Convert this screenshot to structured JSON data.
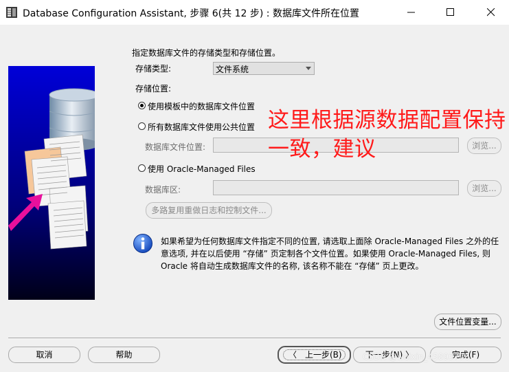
{
  "window": {
    "title": "Database Configuration Assistant, 步骤 6(共 12 步) : 数据库文件所在位置",
    "icon": "app-window-icon",
    "controls": [
      "minimize-icon",
      "maximize-icon",
      "close-icon"
    ]
  },
  "form": {
    "intro": "指定数据库文件的存储类型和存储位置。",
    "storage_type_label": "存储类型:",
    "storage_type_value": "文件系统",
    "storage_location_label": "存储位置:",
    "options": {
      "template": "使用模板中的数据库文件位置",
      "common": "所有数据库文件使用公共位置",
      "omf": "使用 Oracle-Managed Files"
    },
    "selected_option": "template",
    "db_file_location_label": "数据库文件位置:",
    "db_file_location_value": "",
    "browse_label": "浏览...",
    "db_area_label": "数据库区:",
    "db_area_value": "",
    "multiplex_label": "多路复用重做日志和控制文件..."
  },
  "info": {
    "text": "如果希望为任何数据库文件指定不同的位置, 请选取上面除 Oracle-Managed Files 之外的任意选项, 并在以后使用 “存储” 页定制各个文件位置。如果使用 Oracle-Managed Files, 则 Oracle 将自动生成数据库文件的名称, 该名称不能在 “存储” 页上更改。"
  },
  "annotation": {
    "text": "这里根据源数据配置保持一致，建议",
    "color": "#ff1a1a"
  },
  "buttons": {
    "file_location_vars": "文件位置变量...",
    "cancel": "取消",
    "help": "帮助",
    "back": "上一步(B)",
    "next": "下一步(N)",
    "finish": "完成(F)"
  },
  "watermark": "CSDN @weixin_45893776",
  "colors": {
    "accent_blue": "#0000cc",
    "annotation_red": "#ff1a1a",
    "arrow_magenta": "#e8109c"
  }
}
